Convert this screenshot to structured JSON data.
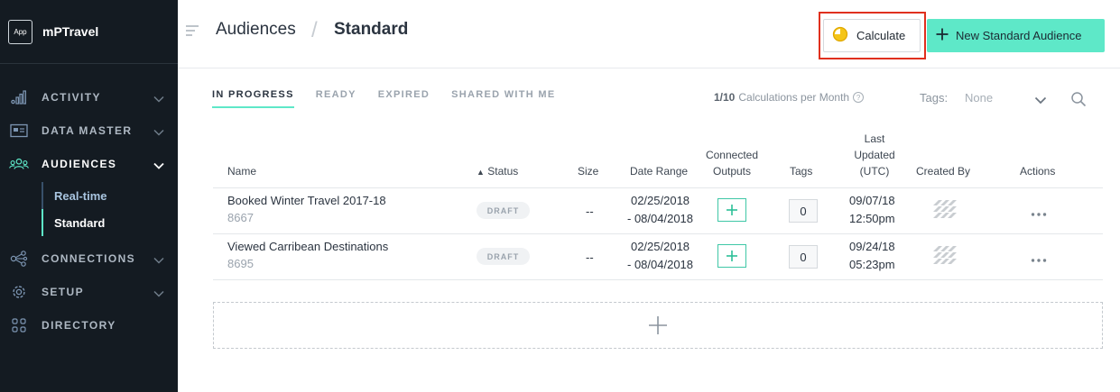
{
  "app": {
    "badge": "App",
    "name": "mPTravel"
  },
  "sidebar": {
    "items": [
      {
        "label": "ACTIVITY",
        "icon": "activity-bars-icon"
      },
      {
        "label": "DATA MASTER",
        "icon": "data-master-icon"
      },
      {
        "label": "AUDIENCES",
        "icon": "audiences-people-icon"
      },
      {
        "label": "CONNECTIONS",
        "icon": "connections-icon"
      },
      {
        "label": "SETUP",
        "icon": "gear-icon"
      },
      {
        "label": "DIRECTORY",
        "icon": "directory-grid-icon"
      }
    ],
    "subitems": [
      {
        "label": "Real-time"
      },
      {
        "label": "Standard"
      }
    ]
  },
  "header": {
    "crumb_root": "Audiences",
    "crumb_sep": "/",
    "crumb_current": "Standard",
    "calculate_label": "Calculate",
    "new_label": "New Standard Audience"
  },
  "tabs": [
    {
      "label": "IN PROGRESS"
    },
    {
      "label": "READY"
    },
    {
      "label": "EXPIRED"
    },
    {
      "label": "SHARED WITH ME"
    }
  ],
  "quota": {
    "count": "1/10",
    "label": "Calculations per Month",
    "help": "?"
  },
  "tags_filter": {
    "label": "Tags:",
    "value": "None"
  },
  "table": {
    "headers": {
      "name": "Name",
      "status": "Status",
      "status_sort": "▲",
      "size": "Size",
      "date_range": "Date Range",
      "connected_1": "Connected",
      "connected_2": "Outputs",
      "tags": "Tags",
      "updated_1": "Last",
      "updated_2": "Updated",
      "updated_3": "(UTC)",
      "created_by": "Created By",
      "actions": "Actions"
    },
    "rows": [
      {
        "name": "Booked Winter Travel 2017-18",
        "id": "8667",
        "status": "DRAFT",
        "size": "--",
        "date_from": "02/25/2018",
        "date_to": "- 08/04/2018",
        "tags": "0",
        "updated_date": "09/07/18",
        "updated_time": "12:50pm"
      },
      {
        "name": "Viewed Carribean Destinations",
        "id": "8695",
        "status": "DRAFT",
        "size": "--",
        "date_from": "02/25/2018",
        "date_to": "- 08/04/2018",
        "tags": "0",
        "updated_date": "09/24/18",
        "updated_time": "05:23pm"
      }
    ]
  },
  "colors": {
    "accent": "#5ee8c8",
    "sidebar_bg": "#141b22",
    "highlight": "#e0301e"
  }
}
